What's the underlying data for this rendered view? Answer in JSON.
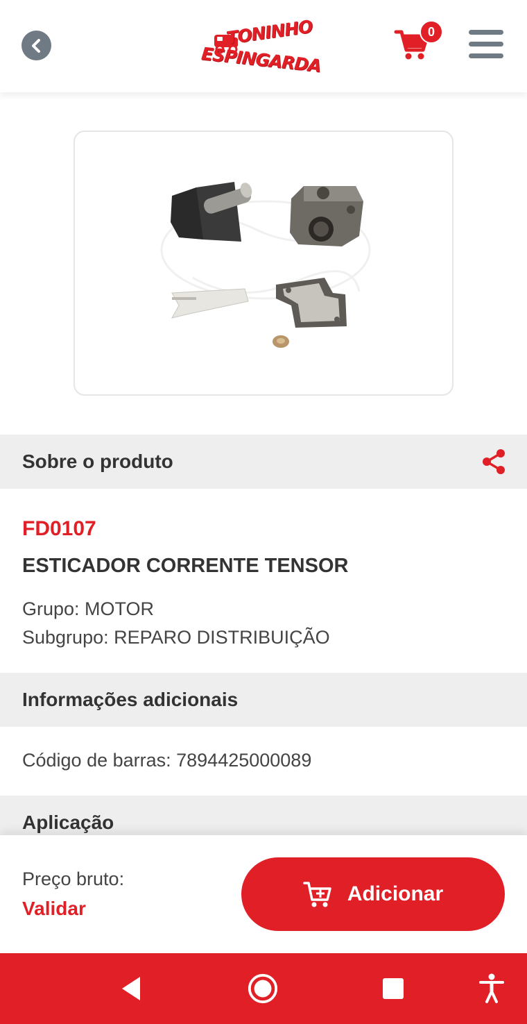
{
  "header": {
    "logo_line1": "TONINHO",
    "logo_line2": "ESPINGARDA",
    "logo_reg": "®",
    "cart_count": "0"
  },
  "sections": {
    "about_title": "Sobre o produto",
    "additional_title": "Informações adicionais",
    "application_title": "Aplicação"
  },
  "product": {
    "code": "FD0107",
    "name": "ESTICADOR CORRENTE TENSOR",
    "group": "Grupo: MOTOR",
    "subgroup": "Subgrupo: REPARO DISTRIBUIÇÃO",
    "barcode": "Código de barras: 7894425000089"
  },
  "price": {
    "label": "Preço bruto:",
    "value": "Validar",
    "add_button_label": "Adicionar"
  },
  "colors": {
    "brand_red": "#e11f26",
    "icon_gray": "#6f7a84",
    "section_bg": "#eeeeee"
  },
  "icons": {
    "back": "chevron-left-icon",
    "cart": "cart-icon",
    "menu": "hamburger-menu-icon",
    "share": "share-icon",
    "add_cart": "cart-plus-icon",
    "nav_back": "triangle-back-icon",
    "nav_home": "circle-home-icon",
    "nav_recents": "square-recents-icon",
    "accessibility": "accessibility-icon"
  }
}
